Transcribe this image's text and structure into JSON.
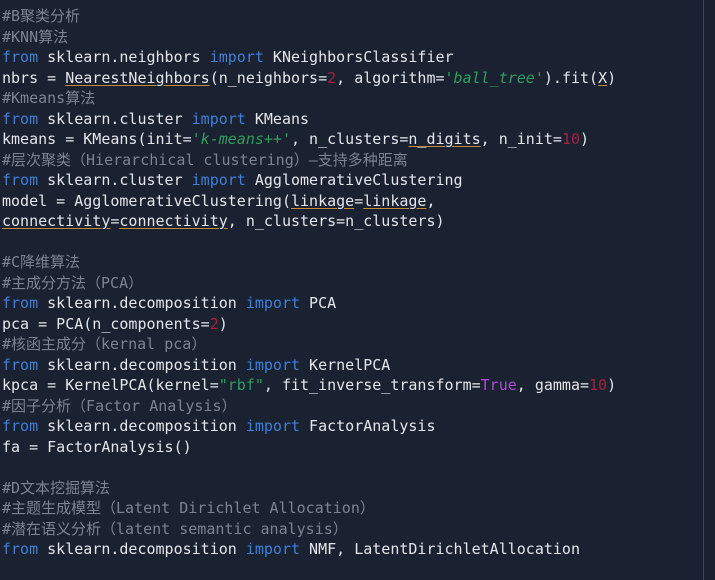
{
  "editor": {
    "background_color": "#1a2131",
    "ruler_color": "#3a4457",
    "colors": {
      "keyword": "#3f7fd6",
      "identifier": "#e4e6ea",
      "string": "#2e9e5b",
      "number": "#a8213a",
      "boolean": "#b14ad6",
      "comment": "#7b8394",
      "spellcheck_underline": "#c28b3a"
    }
  },
  "lines": [
    {
      "n": 1,
      "tokens": [
        {
          "t": "cmt",
          "v": "#B聚类分析"
        }
      ]
    },
    {
      "n": 2,
      "tokens": [
        {
          "t": "cmt",
          "v": "#KNN算法"
        }
      ]
    },
    {
      "n": 3,
      "tokens": [
        {
          "t": "kw",
          "v": "from"
        },
        {
          "t": "id",
          "v": " sklearn.neighbors "
        },
        {
          "t": "kw",
          "v": "import"
        },
        {
          "t": "id",
          "v": " KNeighborsClassifier"
        }
      ]
    },
    {
      "n": 4,
      "tokens": [
        {
          "t": "id",
          "v": "nbrs = "
        },
        {
          "t": "sp",
          "v": "NearestNeighbors"
        },
        {
          "t": "id",
          "v": "(n_neighbors="
        },
        {
          "t": "num",
          "v": "2"
        },
        {
          "t": "id",
          "v": ", algorithm="
        },
        {
          "t": "str",
          "v": "'ball_tree'"
        },
        {
          "t": "id",
          "v": ")."
        },
        {
          "t": "id",
          "v": "fit("
        },
        {
          "t": "sp",
          "v": "X"
        },
        {
          "t": "id",
          "v": ")"
        }
      ]
    },
    {
      "n": 5,
      "tokens": [
        {
          "t": "cmt",
          "v": "#Kmeans算法"
        }
      ]
    },
    {
      "n": 6,
      "tokens": [
        {
          "t": "kw",
          "v": "from"
        },
        {
          "t": "id",
          "v": " sklearn.cluster "
        },
        {
          "t": "kw",
          "v": "import"
        },
        {
          "t": "id",
          "v": " KMeans"
        }
      ]
    },
    {
      "n": 7,
      "tokens": [
        {
          "t": "id",
          "v": "kmeans = KMeans(init="
        },
        {
          "t": "str",
          "v": "'k-means++'"
        },
        {
          "t": "id",
          "v": ", n_clusters="
        },
        {
          "t": "sp",
          "v": "n_digits"
        },
        {
          "t": "id",
          "v": ", n_init="
        },
        {
          "t": "num",
          "v": "10"
        },
        {
          "t": "id",
          "v": ")"
        }
      ]
    },
    {
      "n": 8,
      "tokens": [
        {
          "t": "cmt",
          "v": "#层次聚类（Hierarchical clustering）—支持多种距离"
        }
      ]
    },
    {
      "n": 9,
      "tokens": [
        {
          "t": "kw",
          "v": "from"
        },
        {
          "t": "id",
          "v": " sklearn.cluster "
        },
        {
          "t": "kw",
          "v": "import"
        },
        {
          "t": "id",
          "v": " AgglomerativeClustering"
        }
      ]
    },
    {
      "n": 10,
      "tokens": [
        {
          "t": "id",
          "v": "model = AgglomerativeClustering("
        },
        {
          "t": "sp",
          "v": "linkage"
        },
        {
          "t": "id",
          "v": "="
        },
        {
          "t": "sp",
          "v": "linkage"
        },
        {
          "t": "id",
          "v": ","
        }
      ]
    },
    {
      "n": 11,
      "tokens": [
        {
          "t": "sp",
          "v": "connectivity"
        },
        {
          "t": "id",
          "v": "="
        },
        {
          "t": "sp",
          "v": "connectivity"
        },
        {
          "t": "id",
          "v": ", n_clusters=n_clusters)"
        }
      ]
    },
    {
      "n": 12,
      "tokens": [
        {
          "t": "id",
          "v": ""
        }
      ]
    },
    {
      "n": 13,
      "tokens": [
        {
          "t": "cmt",
          "v": "#C降维算法"
        }
      ]
    },
    {
      "n": 14,
      "tokens": [
        {
          "t": "cmt",
          "v": "#主成分方法（PCA）"
        }
      ]
    },
    {
      "n": 15,
      "tokens": [
        {
          "t": "kw",
          "v": "from"
        },
        {
          "t": "id",
          "v": " sklearn.decomposition "
        },
        {
          "t": "kw",
          "v": "import"
        },
        {
          "t": "id",
          "v": " PCA"
        }
      ]
    },
    {
      "n": 16,
      "tokens": [
        {
          "t": "id",
          "v": "pca = PCA(n_components="
        },
        {
          "t": "num",
          "v": "2"
        },
        {
          "t": "id",
          "v": ")"
        }
      ]
    },
    {
      "n": 17,
      "tokens": [
        {
          "t": "cmt",
          "v": "#核函主成分（kernal pca）"
        }
      ]
    },
    {
      "n": 18,
      "tokens": [
        {
          "t": "kw",
          "v": "from"
        },
        {
          "t": "id",
          "v": " sklearn.decomposition "
        },
        {
          "t": "kw",
          "v": "import"
        },
        {
          "t": "id",
          "v": " KernelPCA"
        }
      ]
    },
    {
      "n": 19,
      "tokens": [
        {
          "t": "id",
          "v": "kpca = KernelPCA(kernel="
        },
        {
          "t": "str2",
          "v": "\"rbf\""
        },
        {
          "t": "id",
          "v": ", fit_inverse_transform="
        },
        {
          "t": "bool",
          "v": "True"
        },
        {
          "t": "id",
          "v": ", gamma="
        },
        {
          "t": "num",
          "v": "10"
        },
        {
          "t": "id",
          "v": ")"
        }
      ]
    },
    {
      "n": 20,
      "tokens": [
        {
          "t": "cmt",
          "v": "#因子分析（Factor Analysis）"
        }
      ]
    },
    {
      "n": 21,
      "tokens": [
        {
          "t": "kw",
          "v": "from"
        },
        {
          "t": "id",
          "v": " sklearn.decomposition "
        },
        {
          "t": "kw",
          "v": "import"
        },
        {
          "t": "id",
          "v": " FactorAnalysis"
        }
      ]
    },
    {
      "n": 22,
      "tokens": [
        {
          "t": "id",
          "v": "fa = FactorAnalysis()"
        }
      ]
    },
    {
      "n": 23,
      "tokens": [
        {
          "t": "id",
          "v": ""
        }
      ]
    },
    {
      "n": 24,
      "tokens": [
        {
          "t": "cmt",
          "v": "#D文本挖掘算法"
        }
      ]
    },
    {
      "n": 25,
      "tokens": [
        {
          "t": "cmt",
          "v": "#主题生成模型（Latent Dirichlet Allocation）"
        }
      ]
    },
    {
      "n": 26,
      "tokens": [
        {
          "t": "cmt",
          "v": "#潜在语义分析（latent semantic analysis）"
        }
      ]
    },
    {
      "n": 27,
      "tokens": [
        {
          "t": "kw",
          "v": "from"
        },
        {
          "t": "id",
          "v": " sklearn.decomposition "
        },
        {
          "t": "kw",
          "v": "import"
        },
        {
          "t": "id",
          "v": " NMF, LatentDirichletAllocation"
        }
      ]
    }
  ]
}
